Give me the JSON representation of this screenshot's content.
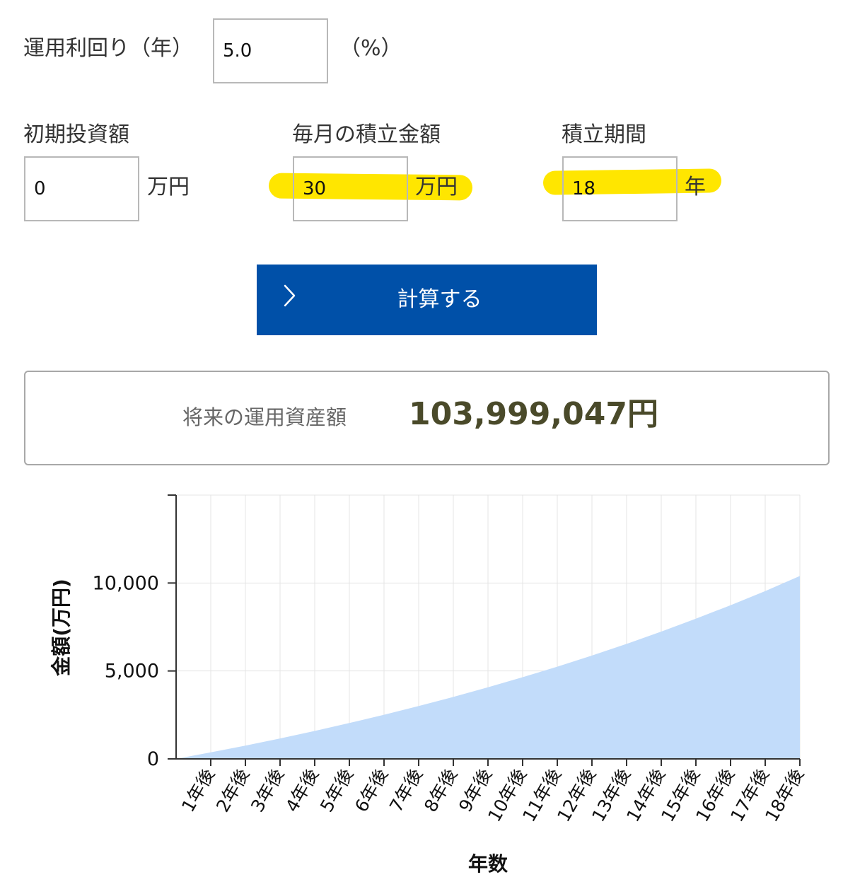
{
  "form": {
    "rate_label": "運用利回り（年）",
    "rate_value": "5.0",
    "rate_unit": "（%）",
    "initial_label": "初期投資額",
    "initial_value": "0",
    "initial_unit": "万円",
    "monthly_label": "毎月の積立金額",
    "monthly_value": "30",
    "monthly_unit": "万円",
    "period_label": "積立期間",
    "period_value": "18",
    "period_unit": "年",
    "calc_button": "計算する"
  },
  "result": {
    "label": "将来の運用資産額",
    "value": "103,999,047円"
  },
  "colors": {
    "button": "#0050a8",
    "highlight": "#ffe600",
    "area_fill": "#c2dcfa"
  },
  "chart_data": {
    "type": "area",
    "categories": [
      "1年後",
      "2年後",
      "3年後",
      "4年後",
      "5年後",
      "6年後",
      "7年後",
      "8年後",
      "9年後",
      "10年後",
      "11年後",
      "12年後",
      "13年後",
      "14年後",
      "15年後",
      "16年後",
      "17年後",
      "18年後"
    ],
    "values": [
      368,
      755,
      1162,
      1589,
      2038,
      2509,
      3004,
      3524,
      4070,
      4643,
      5245,
      5877,
      6540,
      7237,
      7969,
      8737,
      9544,
      10400
    ],
    "ylabel": "金額(万円)",
    "xlabel": "年数",
    "y_ticks": [
      "0",
      "5,000",
      "10,000"
    ],
    "y_tick_values": [
      0,
      5000,
      10000
    ],
    "ylim": [
      0,
      15000
    ],
    "grid": true
  }
}
